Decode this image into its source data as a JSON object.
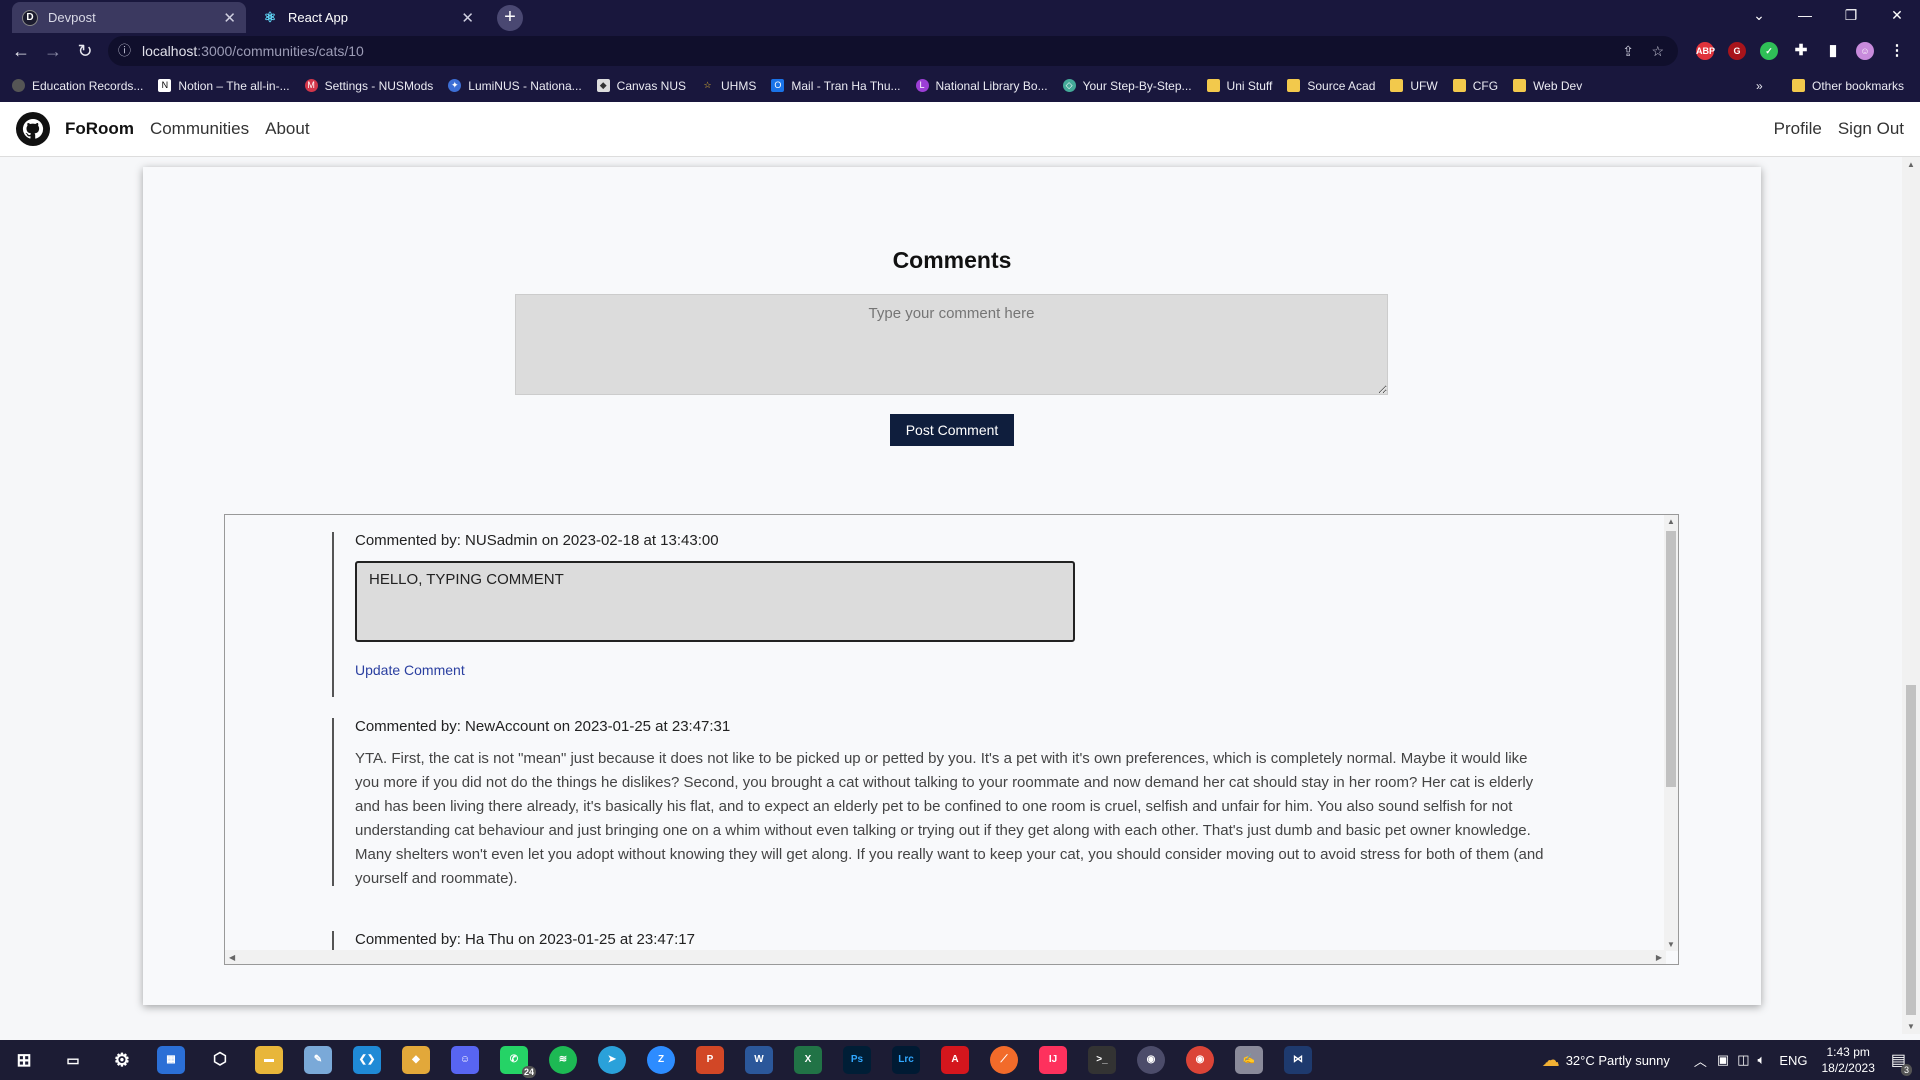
{
  "browser": {
    "tabs": [
      {
        "label": "Devpost",
        "active": false
      },
      {
        "label": "React App",
        "active": true
      }
    ],
    "url_host": "localhost",
    "url_path": ":3000/communities/cats/10",
    "bookmarks": [
      "Education Records...",
      "Notion – The all-in-...",
      "Settings - NUSMods",
      "LumiNUS - Nationa...",
      "Canvas NUS",
      "UHMS",
      "Mail - Tran Ha Thu...",
      "National Library Bo...",
      "Your Step-By-Step...",
      "Uni Stuff",
      "Source Acad",
      "UFW",
      "CFG",
      "Web Dev"
    ],
    "other_bookmarks": "Other bookmarks",
    "more": "»"
  },
  "app": {
    "brand": "FoRoom",
    "nav": {
      "communities": "Communities",
      "about": "About",
      "profile": "Profile",
      "sign_out": "Sign Out"
    }
  },
  "comments_section": {
    "title": "Comments",
    "placeholder": "Type your comment here",
    "post_button": "Post Comment",
    "items": [
      {
        "meta": "Commented by: NUSadmin on 2023-02-18 at 13:43:00",
        "edit_value": "HELLO, TYPING COMMENT",
        "update_label": "Update Comment"
      },
      {
        "meta": "Commented by: NewAccount on 2023-01-25 at 23:47:31",
        "body": "YTA. First, the cat is not \"mean\" just because it does not like to be picked up or petted by you. It's a pet with it's own preferences, which is completely normal. Maybe it would like you more if you did not do the things he dislikes? Second, you brought a cat without talking to your roommate and now demand her cat should stay in her room? Her cat is elderly and has been living there already, it's basically his flat, and to expect an elderly pet to be confined to one room is cruel, selfish and unfair for him. You also sound selfish for not understanding cat behaviour and just bringing one on a whim without even talking or trying out if they get along with each other. That's just dumb and basic pet owner knowledge. Many shelters won't even let you adopt without knowing they will get along. If you really want to keep your cat, you should consider moving out to avoid stress for both of them (and yourself and roommate)."
      },
      {
        "meta": "Commented by: Ha Thu on 2023-01-25 at 23:47:17"
      }
    ]
  },
  "taskbar": {
    "weather": "32°C  Partly sunny",
    "lang": "ENG",
    "time": "1:43 pm",
    "date": "18/2/2023",
    "whatsapp_badge": "24",
    "notif_badge": "3"
  }
}
